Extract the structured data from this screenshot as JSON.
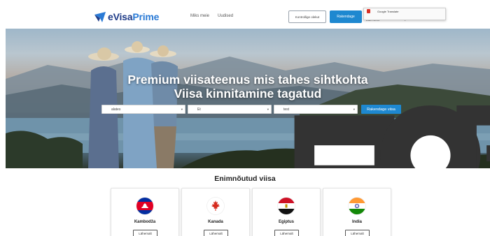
{
  "header": {
    "logo_brand_e": "e",
    "logo_brand_visa": "Visa",
    "logo_brand_prime": "Prime",
    "nav": [
      "Miks meie",
      "Uudised"
    ],
    "check_button": "Kontrollige olekut",
    "apply_button": "Rakendage",
    "language_value": "Vali keel",
    "google_translate_label": "Google Translate",
    "colors": {
      "brand_dark": "#1f3c88",
      "brand_light": "#2b7bd6",
      "accent": "#1e88d0"
    }
  },
  "hero": {
    "title_line1": "Premium viisateenus mis tahes sihtkohta",
    "title_line2": "Viisa kinnitamine tagatud",
    "search": {
      "from_value": "alates",
      "to_value": "Et",
      "visa_type_value": "test",
      "submit_label": "Rakendage viisa"
    }
  },
  "popular": {
    "title": "Enimnõutud viisa",
    "cards": [
      {
        "country": "Kambodža",
        "button": "Lähemalt",
        "flag": "cambodia-flag-icon"
      },
      {
        "country": "Kanada",
        "button": "Lähemalt",
        "flag": "canada-flag-icon"
      },
      {
        "country": "Egiptus",
        "button": "Lähemalt",
        "flag": "egypt-flag-icon"
      },
      {
        "country": "India",
        "button": "Lähemalt",
        "flag": "india-flag-icon"
      }
    ]
  }
}
